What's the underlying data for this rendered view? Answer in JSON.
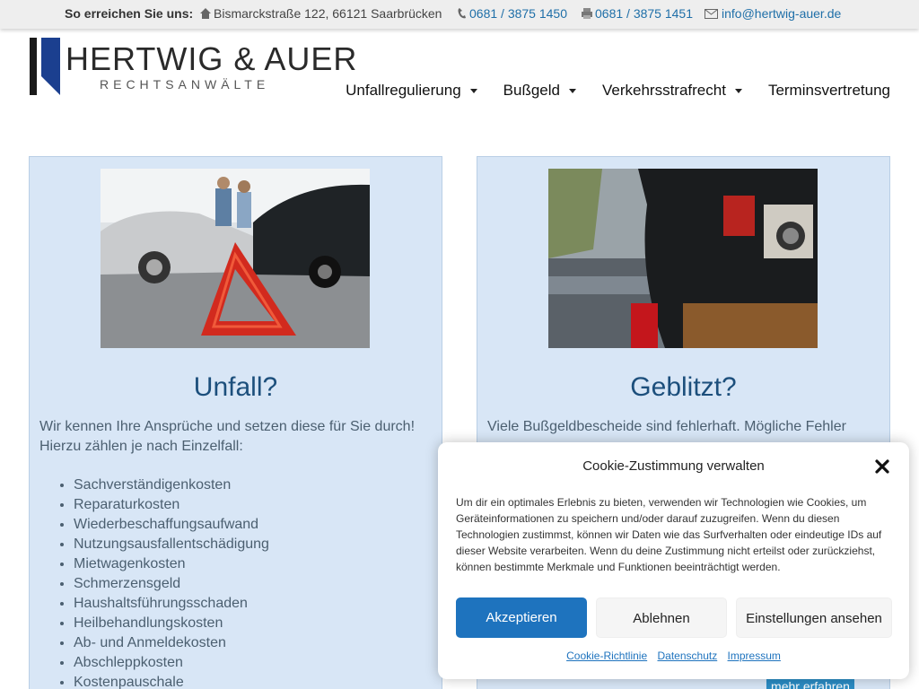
{
  "topbar": {
    "lead": "So erreichen Sie uns:",
    "address": "Bismarckstraße 122, 66121 Saarbrücken",
    "phone": "0681 / 3875 1450",
    "fax": "0681 / 3875 1451",
    "email": "info@hertwig-auer.de",
    "icons": [
      "home-icon",
      "phone-icon",
      "fax-icon",
      "mail-icon"
    ]
  },
  "logo": {
    "name": "HERTWIG & AUER",
    "subtitle": "RECHTSANWÄLTE"
  },
  "nav": {
    "items": [
      {
        "label": "Unfallregulierung",
        "has_dropdown": true
      },
      {
        "label": "Bußgeld",
        "has_dropdown": true
      },
      {
        "label": "Verkehrsstrafrecht",
        "has_dropdown": true
      },
      {
        "label": "Terminsvertretung",
        "has_dropdown": false
      }
    ]
  },
  "cards": {
    "left": {
      "title": "Unfall?",
      "intro": "Wir kennen Ihre Ansprüche und setzen diese für Sie durch! Hierzu zählen je nach Einzelfall:",
      "items": [
        "Sachverständigenkosten",
        "Reparaturkosten",
        "Wiederbeschaffungsaufwand",
        "Nutzungsausfallentschädigung",
        "Mietwagenkosten",
        "Schmerzensgeld",
        "Haushaltsführungsschaden",
        "Heilbehandlungskosten",
        "Ab- und Anmeldekosten",
        "Abschleppkosten",
        "Kostenpauschale"
      ]
    },
    "right": {
      "title": "Geblitzt?",
      "intro": "Viele Bußgeldbescheide sind fehlerhaft. Mögliche Fehler",
      "more_label": "mehr erfahren"
    }
  },
  "cookie": {
    "title": "Cookie-Zustimmung verwalten",
    "body": "Um dir ein optimales Erlebnis zu bieten, verwenden wir Technologien wie Cookies, um Geräteinformationen zu speichern und/oder darauf zuzugreifen. Wenn du diesen Technologien zustimmst, können wir Daten wie das Surfverhalten oder eindeutige IDs auf dieser Website verarbeiten. Wenn du deine Zustimmung nicht erteilst oder zurückziehst, können bestimmte Merkmale und Funktionen beeinträchtigt werden.",
    "accept": "Akzeptieren",
    "deny": "Ablehnen",
    "preferences": "Einstellungen ansehen",
    "links": [
      "Cookie-Richtlinie",
      "Datenschutz",
      "Impressum"
    ]
  },
  "colors": {
    "accent": "#1e73be",
    "card_bg": "#d8e6f6",
    "heading": "#1c4f7c",
    "link": "#1f6fa8"
  }
}
